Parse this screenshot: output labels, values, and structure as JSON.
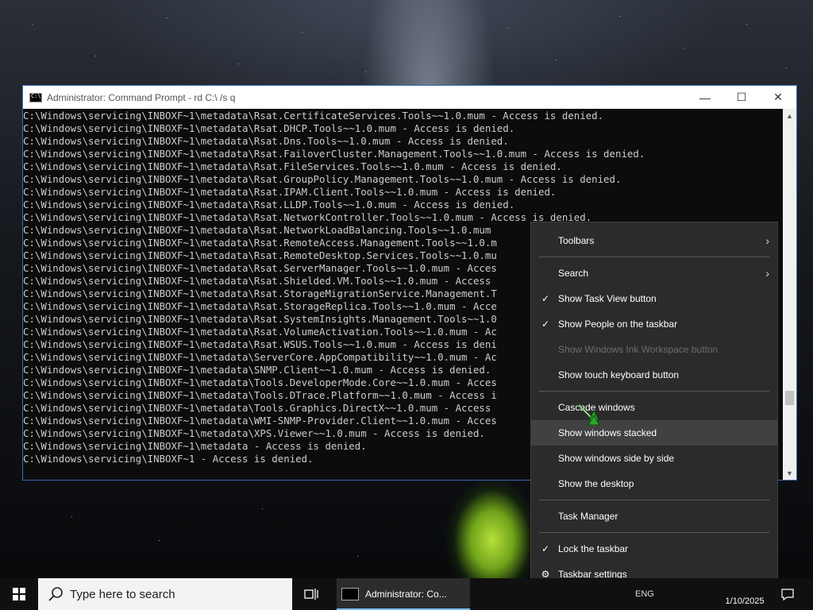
{
  "window": {
    "title": "Administrator: Command Prompt - rd  C:\\ /s q",
    "minimize_glyph": "—",
    "maximize_glyph": "☐",
    "close_glyph": "✕"
  },
  "console": {
    "lines": [
      "C:\\Windows\\servicing\\INBOXF~1\\metadata\\Rsat.CertificateServices.Tools~~1.0.mum - Access is denied.",
      "C:\\Windows\\servicing\\INBOXF~1\\metadata\\Rsat.DHCP.Tools~~1.0.mum - Access is denied.",
      "C:\\Windows\\servicing\\INBOXF~1\\metadata\\Rsat.Dns.Tools~~1.0.mum - Access is denied.",
      "C:\\Windows\\servicing\\INBOXF~1\\metadata\\Rsat.FailoverCluster.Management.Tools~~1.0.mum - Access is denied.",
      "C:\\Windows\\servicing\\INBOXF~1\\metadata\\Rsat.FileServices.Tools~~1.0.mum - Access is denied.",
      "C:\\Windows\\servicing\\INBOXF~1\\metadata\\Rsat.GroupPolicy.Management.Tools~~1.0.mum - Access is denied.",
      "C:\\Windows\\servicing\\INBOXF~1\\metadata\\Rsat.IPAM.Client.Tools~~1.0.mum - Access is denied.",
      "C:\\Windows\\servicing\\INBOXF~1\\metadata\\Rsat.LLDP.Tools~~1.0.mum - Access is denied.",
      "C:\\Windows\\servicing\\INBOXF~1\\metadata\\Rsat.NetworkController.Tools~~1.0.mum - Access is denied.",
      "C:\\Windows\\servicing\\INBOXF~1\\metadata\\Rsat.NetworkLoadBalancing.Tools~~1.0.mum",
      "C:\\Windows\\servicing\\INBOXF~1\\metadata\\Rsat.RemoteAccess.Management.Tools~~1.0.m",
      "C:\\Windows\\servicing\\INBOXF~1\\metadata\\Rsat.RemoteDesktop.Services.Tools~~1.0.mu",
      "C:\\Windows\\servicing\\INBOXF~1\\metadata\\Rsat.ServerManager.Tools~~1.0.mum - Acces",
      "C:\\Windows\\servicing\\INBOXF~1\\metadata\\Rsat.Shielded.VM.Tools~~1.0.mum - Access",
      "C:\\Windows\\servicing\\INBOXF~1\\metadata\\Rsat.StorageMigrationService.Management.T",
      "C:\\Windows\\servicing\\INBOXF~1\\metadata\\Rsat.StorageReplica.Tools~~1.0.mum - Acce",
      "C:\\Windows\\servicing\\INBOXF~1\\metadata\\Rsat.SystemInsights.Management.Tools~~1.0",
      "C:\\Windows\\servicing\\INBOXF~1\\metadata\\Rsat.VolumeActivation.Tools~~1.0.mum - Ac",
      "C:\\Windows\\servicing\\INBOXF~1\\metadata\\Rsat.WSUS.Tools~~1.0.mum - Access is deni",
      "C:\\Windows\\servicing\\INBOXF~1\\metadata\\ServerCore.AppCompatibility~~1.0.mum - Ac",
      "C:\\Windows\\servicing\\INBOXF~1\\metadata\\SNMP.Client~~1.0.mum - Access is denied.",
      "C:\\Windows\\servicing\\INBOXF~1\\metadata\\Tools.DeveloperMode.Core~~1.0.mum - Acces",
      "C:\\Windows\\servicing\\INBOXF~1\\metadata\\Tools.DTrace.Platform~~1.0.mum - Access i",
      "C:\\Windows\\servicing\\INBOXF~1\\metadata\\Tools.Graphics.DirectX~~1.0.mum - Access",
      "C:\\Windows\\servicing\\INBOXF~1\\metadata\\WMI-SNMP-Provider.Client~~1.0.mum - Acces",
      "C:\\Windows\\servicing\\INBOXF~1\\metadata\\XPS.Viewer~~1.0.mum - Access is denied.",
      "C:\\Windows\\servicing\\INBOXF~1\\metadata - Access is denied.",
      "C:\\Windows\\servicing\\INBOXF~1 - Access is denied."
    ]
  },
  "context_menu": {
    "items": [
      {
        "label": "Toolbars",
        "checked": false,
        "submenu": true,
        "disabled": false
      },
      {
        "label": "Search",
        "checked": false,
        "submenu": true,
        "disabled": false
      },
      {
        "label": "Show Task View button",
        "checked": true,
        "submenu": false,
        "disabled": false
      },
      {
        "label": "Show People on the taskbar",
        "checked": true,
        "submenu": false,
        "disabled": false
      },
      {
        "label": "Show Windows Ink Workspace button",
        "checked": false,
        "submenu": false,
        "disabled": true
      },
      {
        "label": "Show touch keyboard button",
        "checked": false,
        "submenu": false,
        "disabled": false
      },
      {
        "label": "Cascade windows",
        "checked": false,
        "submenu": false,
        "disabled": false
      },
      {
        "label": "Show windows stacked",
        "checked": false,
        "submenu": false,
        "disabled": false,
        "hover": true
      },
      {
        "label": "Show windows side by side",
        "checked": false,
        "submenu": false,
        "disabled": false
      },
      {
        "label": "Show the desktop",
        "checked": false,
        "submenu": false,
        "disabled": false
      },
      {
        "label": "Task Manager",
        "checked": false,
        "submenu": false,
        "disabled": false
      },
      {
        "label": "Lock the taskbar",
        "checked": true,
        "submenu": false,
        "disabled": false
      },
      {
        "label": "Taskbar settings",
        "checked": false,
        "submenu": false,
        "disabled": false,
        "gear": true
      }
    ],
    "check_glyph": "✓",
    "submenu_glyph": "›",
    "gear_glyph": "⚙"
  },
  "taskbar": {
    "search_placeholder": "Type here to search",
    "app_label": "Administrator: Co...",
    "tray_text": "ENG",
    "clock_date": "1/10/2025"
  },
  "colors": {
    "accent": "#76b9ed",
    "menu_bg": "#2b2b2b",
    "console_bg": "#0c0c0c",
    "console_text": "#cccccc"
  }
}
